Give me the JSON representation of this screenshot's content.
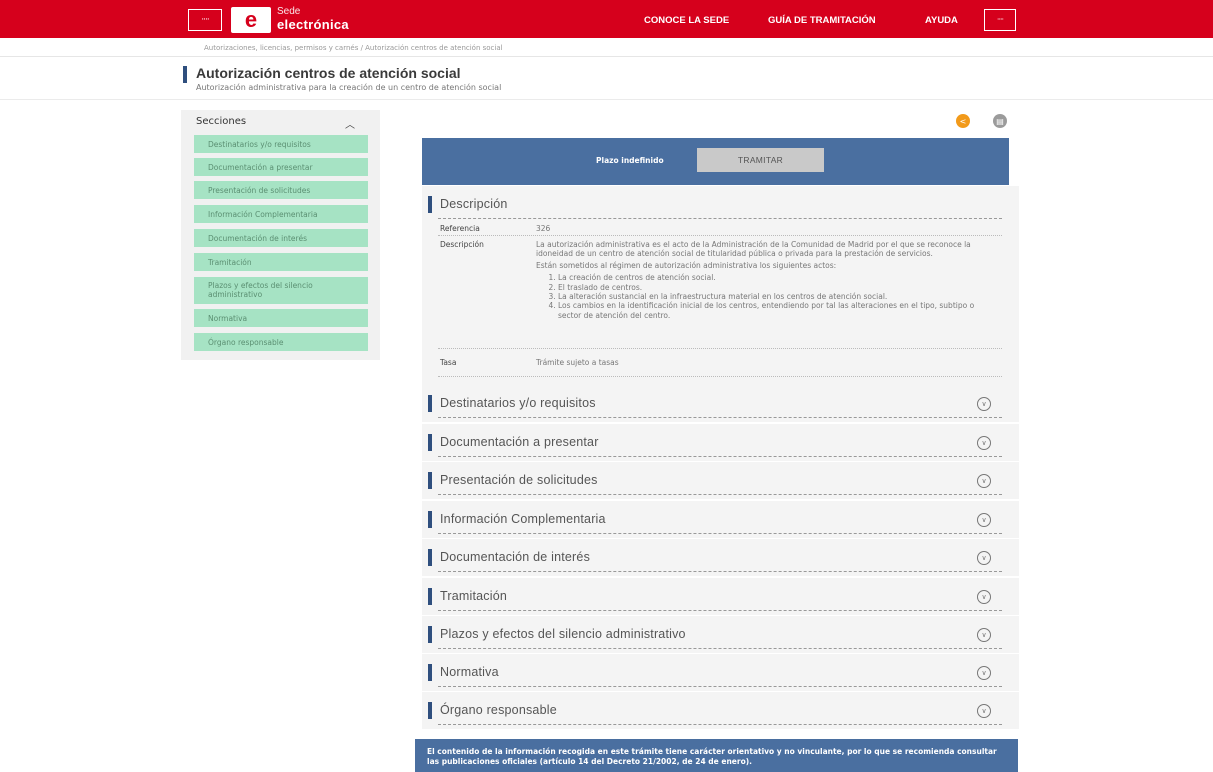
{
  "header": {
    "brand_line1": "Sede",
    "brand_line2": "electrónica",
    "logo_letter": "e",
    "flag_glyph": "····",
    "nav": [
      "CONOCE LA SEDE",
      "GUÍA DE TRAMITACIÓN",
      "AYUDA"
    ]
  },
  "breadcrumb": "Autorizaciones, licencias, permisos y carnés / Autorización centros de atención social",
  "page": {
    "title": "Autorización centros de atención social",
    "subtitle": "Autorización administrativa para la creación de un centro de atención social"
  },
  "sidebar": {
    "heading": "Secciones",
    "items": [
      "Destinatarios y/o requisitos",
      "Documentación a presentar",
      "Presentación de solicitudes",
      "Información Complementaria",
      "Documentación de interés",
      "Tramitación",
      "Plazos y efectos del silencio administrativo",
      "Normativa",
      "Órgano responsable"
    ]
  },
  "actions": {
    "plazo": "Plazo indefinido",
    "tramitar": "TRAMITAR"
  },
  "descripcion": {
    "title": "Descripción",
    "ref_label": "Referencia",
    "ref_value": "326",
    "desc_label": "Descripción",
    "desc_p1": "La autorización administrativa es el acto de la Administración de la Comunidad de Madrid por el que se reconoce la idoneidad de un centro de atención social de titularidad pública o privada para la prestación de servicios.",
    "desc_p2": "Están sometidos al régimen de autorización administrativa los siguientes actos:",
    "desc_list": [
      "La creación de centros de atención social.",
      "El traslado de centros.",
      "La alteración sustancial en la infraestructura material en los centros de atención social.",
      "Los cambios en la identificación inicial de los centros, entendiendo por tal las alteraciones en el tipo, subtipo o sector de atención del centro."
    ],
    "tasa_label": "Tasa",
    "tasa_value": "Trámite sujeto a tasas"
  },
  "accordion": [
    "Destinatarios y/o requisitos",
    "Documentación a presentar",
    "Presentación de solicitudes",
    "Información Complementaria",
    "Documentación de interés",
    "Tramitación",
    "Plazos y efectos del silencio administrativo",
    "Normativa",
    "Órgano responsable"
  ],
  "footer_note": "El contenido de la información recogida en este trámite tiene carácter orientativo y no vinculante, por lo que se recomienda consultar las publicaciones oficiales (artículo 14 del Decreto 21/2002, de 24 de enero).",
  "colors": {
    "header_red": "#d6001c",
    "navy": "#2f4f7e",
    "blue_panel": "#4a6fa0",
    "side_green": "#a6e3c4",
    "share_orange": "#f29a1a"
  }
}
